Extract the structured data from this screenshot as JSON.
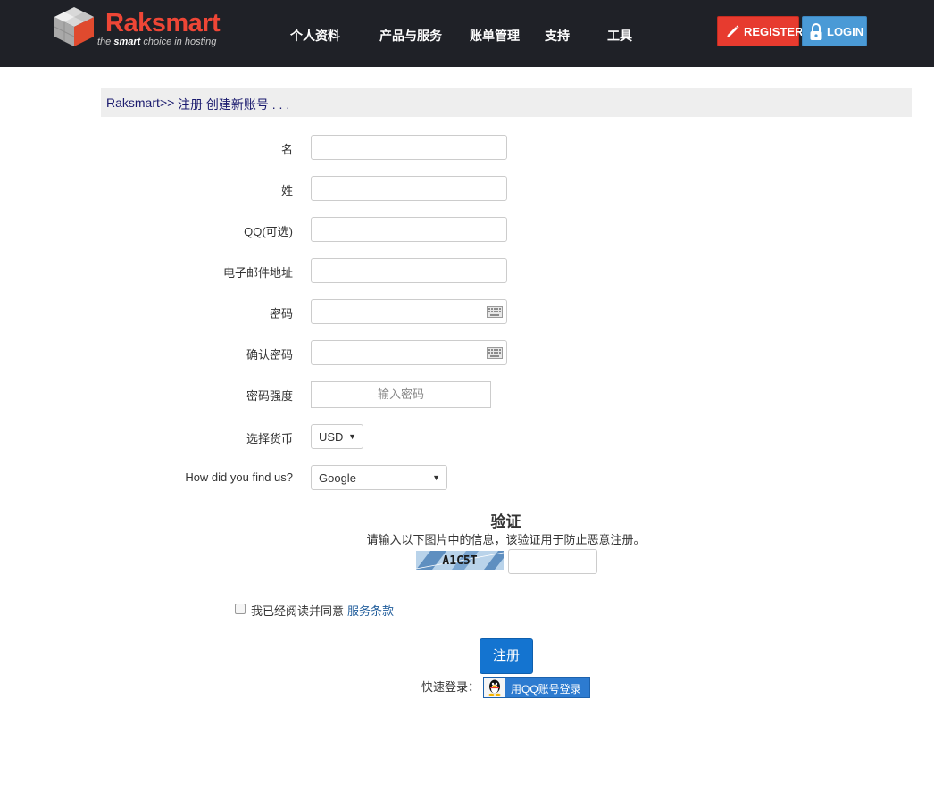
{
  "header": {
    "brand": "Raksmart",
    "tagline_prefix": "the ",
    "tagline_bold": "smart",
    "tagline_suffix": " choice in hosting",
    "nav": [
      "个人资料",
      "产品与服务",
      "账单管理",
      "支持",
      "工具"
    ],
    "register_label": "REGISTER",
    "login_label": "LOGIN"
  },
  "breadcrumb": {
    "home": "Raksmart",
    "separator": ">>",
    "current": "注册 创建新账号 . . ."
  },
  "form": {
    "first_name_label": "名",
    "last_name_label": "姓",
    "qq_label": "QQ(可选)",
    "email_label": "电子邮件地址",
    "password_label": "密码",
    "confirm_password_label": "确认密码",
    "strength_label": "密码强度",
    "strength_text": "输入密码",
    "currency_label": "选择货币",
    "currency_value": "USD",
    "source_label": "How did you find us?",
    "source_value": "Google"
  },
  "verification": {
    "title": "验证",
    "description": "请输入以下图片中的信息，该验证用于防止恶意注册。",
    "captcha_text": "A1C5T"
  },
  "terms": {
    "text": "我已经阅读并同意",
    "link": "服务条款"
  },
  "submit_label": "注册",
  "quick_login": {
    "label": "快速登录：",
    "qq_button": "用QQ账号登录"
  },
  "colors": {
    "header_bg": "#1f2127",
    "brand_red": "#ee4636",
    "register_bg": "#e73b2f",
    "login_bg": "#4a9ad6",
    "submit_bg": "#1474d0",
    "link": "#1e5b9a"
  }
}
